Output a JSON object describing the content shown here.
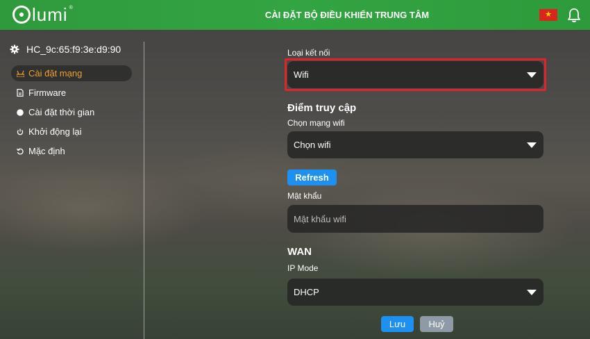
{
  "header": {
    "logo_text": "lumi",
    "logo_mark": "®",
    "title": "CÀI ĐẶT BỘ ĐIỀU KHIỂN TRUNG TÂM",
    "flag_icon": "vietnam-flag-icon",
    "bell_icon": "bell-icon"
  },
  "sidebar": {
    "device_name": "HC_9c:65:f9:3e:d9:90",
    "items": [
      {
        "label": "Cài đặt mạng",
        "icon": "network-icon",
        "active": true
      },
      {
        "label": "Firmware",
        "icon": "document-icon",
        "active": false
      },
      {
        "label": "Cài đặt thời gian",
        "icon": "clock-icon",
        "active": false
      },
      {
        "label": "Khởi động lại",
        "icon": "power-icon",
        "active": false
      },
      {
        "label": "Mặc định",
        "icon": "reset-icon",
        "active": false
      }
    ]
  },
  "form": {
    "connection_type_label": "Loại kết nối",
    "connection_type_value": "Wifi",
    "access_point_title": "Điểm truy cập",
    "wifi_network_label": "Chọn mạng wifi",
    "wifi_network_value": "Chọn wifi",
    "refresh_label": "Refresh",
    "password_label": "Mật khẩu",
    "password_placeholder": "Mật khẩu wifi",
    "wan_title": "WAN",
    "ip_mode_label": "IP Mode",
    "ip_mode_value": "DHCP",
    "save_label": "Lưu",
    "cancel_label": "Huỷ"
  },
  "colors": {
    "header_green": "#33a442",
    "active_menu_text": "#f0a030",
    "primary_button": "#1e90ef",
    "secondary_button": "#8e9aa6",
    "highlight_border": "#e0242c"
  }
}
